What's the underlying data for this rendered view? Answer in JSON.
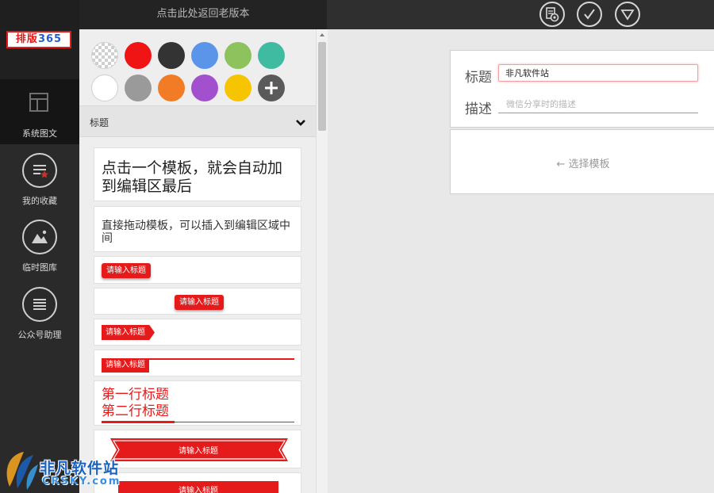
{
  "topbar": {
    "old_version_link": "点击此处返回老版本",
    "icons": [
      "image-settings-icon",
      "check-icon",
      "down-triangle-icon"
    ]
  },
  "logo": {
    "text_a": "排版",
    "text_b": "365"
  },
  "nav": {
    "items": [
      {
        "label": "系统图文",
        "icon": "layout-icon",
        "active": true
      },
      {
        "label": "我的收藏",
        "icon": "favorites-icon",
        "active": false
      },
      {
        "label": "临时图库",
        "icon": "gallery-icon",
        "active": false
      },
      {
        "label": "公众号助理",
        "icon": "list-icon",
        "active": false
      }
    ]
  },
  "palette": {
    "colors": [
      "transparent",
      "#f01414",
      "#333333",
      "#5b95ea",
      "#8dc25c",
      "#3fbba2",
      "#ffffff",
      "#9a9a9a",
      "#f27c25",
      "#a350cf",
      "#f6c400",
      "add"
    ]
  },
  "section": {
    "title": "标题"
  },
  "templates": {
    "t1": "点击一个模板，就会自动加到编辑区最后",
    "t2": "直接拖动模板，可以插入到编辑区域中间",
    "tag": "请输入标题",
    "red_line1": "第一行标题",
    "red_line2": "第二行标题"
  },
  "editor": {
    "title_label": "标题",
    "title_value": "非凡软件站",
    "desc_label": "描述",
    "desc_placeholder": "微信分享时的描述",
    "choose_template": "← 选择模板"
  },
  "watermark": {
    "main": "非凡软件站",
    "sub": "CRSKY.com"
  }
}
